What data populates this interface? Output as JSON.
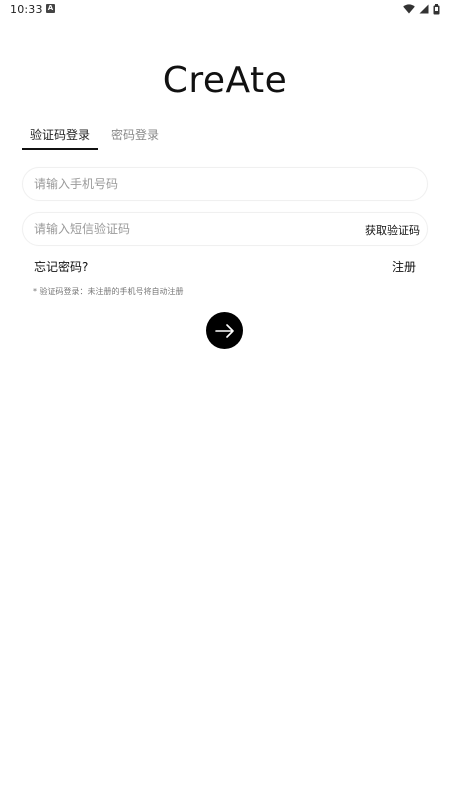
{
  "status_bar": {
    "time": "10:33",
    "notification_badge": "A",
    "icons": [
      "wifi-icon",
      "signal-icon",
      "battery-icon"
    ]
  },
  "brand": {
    "title": "CreAte"
  },
  "tabs": [
    {
      "label": "验证码登录",
      "active": true
    },
    {
      "label": "密码登录",
      "active": false
    }
  ],
  "form": {
    "phone_placeholder": "请输入手机号码",
    "phone_value": "",
    "code_placeholder": "请输入短信验证码",
    "code_value": "",
    "get_code_label": "获取验证码"
  },
  "links": {
    "forgot_password": "忘记密码?",
    "register": "注册"
  },
  "hint": "* 验证码登录：未注册的手机号将自动注册",
  "submit": {
    "icon": "arrow-right-icon"
  },
  "colors": {
    "accent": "#000000",
    "text": "#111111",
    "muted": "#888888",
    "placeholder": "#9a9a9a",
    "border": "#f0f0f0"
  }
}
